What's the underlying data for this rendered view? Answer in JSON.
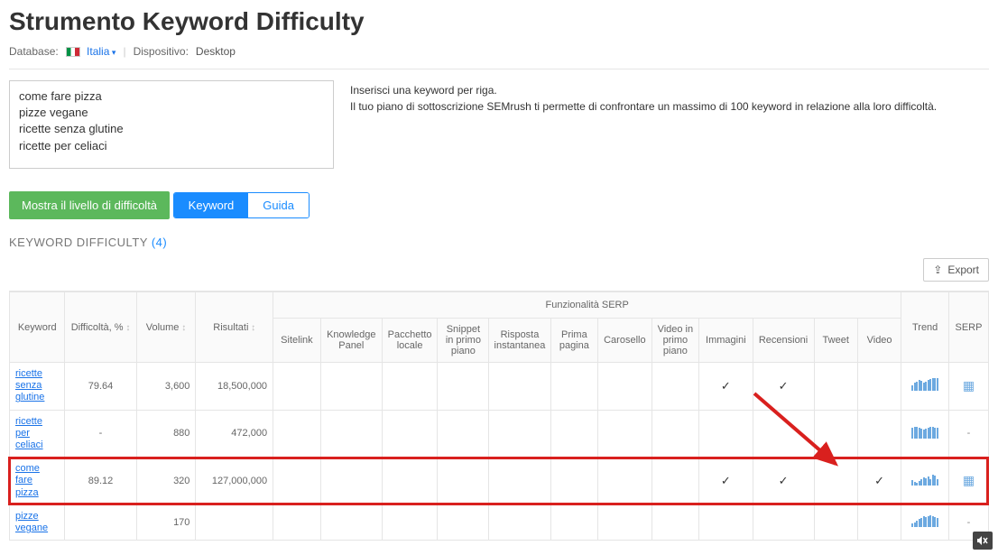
{
  "title": "Strumento Keyword Difficulty",
  "meta": {
    "database_label": "Database:",
    "country": "Italia",
    "device_label": "Dispositivo:",
    "device_value": "Desktop"
  },
  "textarea_value": "come fare pizza\npizze vegane\nricette senza glutine\nricette per celiaci",
  "help": {
    "line1": "Inserisci una keyword per riga.",
    "line2": "Il tuo piano di sottoscrizione SEMrush ti permette di confrontare un massimo di 100 keyword in relazione alla loro difficoltà."
  },
  "show_button": "Mostra il livello di difficoltà",
  "tabs": {
    "keyword": "Keyword",
    "guide": "Guida"
  },
  "section": {
    "label": "KEYWORD DIFFICULTY",
    "count": "(4)"
  },
  "export_label": "Export",
  "columns": {
    "keyword": "Keyword",
    "difficulty": "Difficoltà, %",
    "volume": "Volume",
    "results": "Risultati",
    "serp_group": "Funzionalità SERP",
    "serp": [
      "Sitelink",
      "Knowledge Panel",
      "Pacchetto locale",
      "Snippet in primo piano",
      "Risposta instantanea",
      "Prima pagina",
      "Carosello",
      "Video in primo piano",
      "Immagini",
      "Recensioni",
      "Tweet",
      "Video"
    ],
    "trend": "Trend",
    "serp_col": "SERP"
  },
  "rows": [
    {
      "keyword": "ricette senza glutine",
      "difficulty": "79.64",
      "volume": "3,600",
      "results": "18,500,000",
      "features": {
        "Immagini": true,
        "Recensioni": true
      },
      "trend_bars": [
        6,
        9,
        10,
        12,
        11,
        9,
        10,
        12,
        13,
        14,
        14,
        14
      ],
      "has_serp": true
    },
    {
      "keyword": "ricette per celiaci",
      "difficulty": "-",
      "volume": "880",
      "results": "472,000",
      "features": {},
      "trend_bars": [
        12,
        13,
        13,
        12,
        11,
        10,
        11,
        12,
        13,
        13,
        12,
        12
      ],
      "has_serp": false
    },
    {
      "keyword": "come fare pizza",
      "difficulty": "89.12",
      "volume": "320",
      "results": "127,000,000",
      "features": {
        "Immagini": true,
        "Recensioni": true,
        "Video": true
      },
      "trend_bars": [
        6,
        4,
        3,
        5,
        7,
        9,
        8,
        10,
        7,
        12,
        11,
        7
      ],
      "has_serp": true,
      "highlighted": true
    },
    {
      "keyword": "pizze vegane",
      "difficulty": "",
      "volume": "170",
      "results": "",
      "features": {},
      "trend_bars": [
        4,
        5,
        7,
        9,
        10,
        12,
        11,
        12,
        13,
        12,
        11,
        10
      ],
      "has_serp": false
    }
  ]
}
